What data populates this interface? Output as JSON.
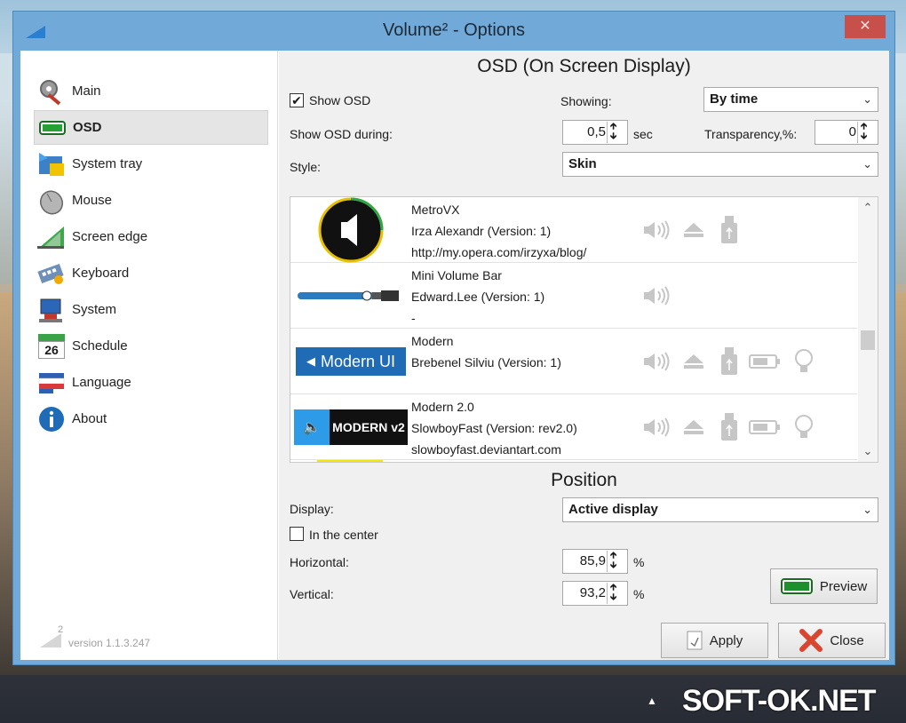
{
  "window": {
    "title": "Volume² - Options",
    "close_glyph": "✕"
  },
  "sidebar": {
    "items": [
      {
        "label": "Main",
        "icon": "gear-wrench-icon"
      },
      {
        "label": "OSD",
        "icon": "osd-bar-icon",
        "active": true
      },
      {
        "label": "System tray",
        "icon": "tray-icon"
      },
      {
        "label": "Mouse",
        "icon": "mouse-icon"
      },
      {
        "label": "Screen edge",
        "icon": "screen-edge-icon"
      },
      {
        "label": "Keyboard",
        "icon": "keyboard-icon"
      },
      {
        "label": "System",
        "icon": "computer-icon"
      },
      {
        "label": "Schedule",
        "icon": "calendar-icon",
        "calendar_day": "26"
      },
      {
        "label": "Language",
        "icon": "flag-icon"
      },
      {
        "label": "About",
        "icon": "info-icon"
      }
    ],
    "version": "version 1.1.3.247",
    "version_sup": "2"
  },
  "osd": {
    "title": "OSD (On Screen Display)",
    "show_osd_label": "Show OSD",
    "show_osd_checked": true,
    "showing_label": "Showing:",
    "showing_value": "By time",
    "show_during_label": "Show OSD during:",
    "show_during_value": "0,5",
    "show_during_unit": "sec",
    "transparency_label": "Transparency,%:",
    "transparency_value": "0",
    "style_label": "Style:",
    "style_value": "Skin",
    "skins": [
      {
        "name": "MetroVX",
        "author": "Irza Alexandr (Version: 1)",
        "url": "http://my.opera.com/irzyxa/blog/",
        "features": [
          "volume-icon",
          "eject-icon",
          "usb-icon"
        ]
      },
      {
        "name": "Mini Volume Bar",
        "author": "Edward.Lee (Version: 1)",
        "url": "-",
        "features": [
          "volume-icon"
        ]
      },
      {
        "name": "Modern",
        "author": "Brebenel Silviu (Version: 1)",
        "url": "",
        "thumb_text": "Modern UI",
        "features": [
          "volume-icon",
          "eject-icon",
          "usb-icon",
          "battery-icon",
          "bulb-icon"
        ]
      },
      {
        "name": "Modern 2.0",
        "author": "SlowboyFast (Version: rev2.0)",
        "url": "slowboyfast.deviantart.com",
        "thumb_text": "MODERN v2",
        "features": [
          "volume-icon",
          "eject-icon",
          "usb-icon",
          "battery-icon",
          "bulb-icon"
        ]
      }
    ]
  },
  "position": {
    "title": "Position",
    "display_label": "Display:",
    "display_value": "Active display",
    "center_label": "In the center",
    "center_checked": false,
    "horizontal_label": "Horizontal:",
    "horizontal_value": "85,9",
    "vertical_label": "Vertical:",
    "vertical_value": "93,2",
    "percent": "%",
    "preview_label": "Preview"
  },
  "footer": {
    "apply_label": "Apply",
    "close_label": "Close"
  },
  "watermark": "SOFT-OK.NET",
  "colors": {
    "window_frame": "#71a9d8",
    "close_red": "#c7504a",
    "accent_blue": "#1f6bb5",
    "osd_green": "#1d8f2b"
  }
}
